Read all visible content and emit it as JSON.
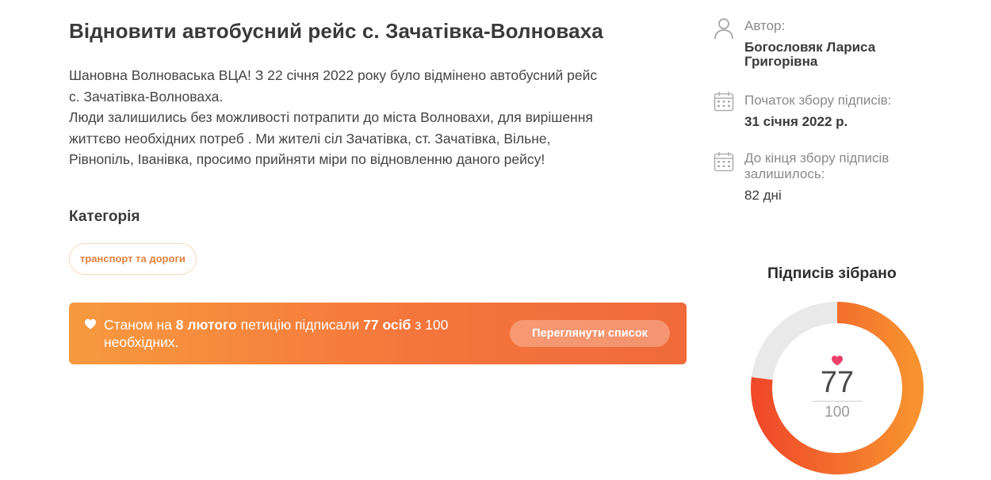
{
  "petition": {
    "title": "Відновити автобусний рейс с. Зачатівка-Волноваха",
    "description_lines": [
      "Шановна Волноваська ВЦА! З 22 січня 2022 року було відмінено автобусний рейс",
      "с. Зачатівка-Волноваха.",
      "Люди залишились без можливості потрапити до міста Волновахи, для вирішення",
      "життєво необхідних потреб . Ми жителі сіл Зачатівка, ст. Зачатівка, Вільне,",
      "Рівнопіль, Іванівка, просимо прийняти міри по відновленню даного рейсу!"
    ]
  },
  "category": {
    "heading": "Категорія",
    "tag": "транспорт та дороги"
  },
  "banner": {
    "text_prefix": "Станом на",
    "date": "8 лютого",
    "text_middle": "петицію підписали",
    "count_text": "77 осіб",
    "text_suffix": "з 100 необхідних.",
    "button_label": "Переглянути список",
    "icon": "heart-icon"
  },
  "sidebar": {
    "author_label": "Автор:",
    "author_name_lines": [
      "Богословяк Лариса",
      "Григорівна"
    ],
    "start_label": "Початок збору підписів:",
    "start_date": "31 січня 2022 р.",
    "remaining_label_lines": [
      "До кінця збору підписів",
      "залишилось:"
    ],
    "remaining_value": "82 дні",
    "icons": [
      "user-icon",
      "calendar-icon",
      "calendar-icon"
    ]
  },
  "signatures": {
    "title": "Підписів зібрано",
    "collected": "77",
    "required": "100",
    "progress_fraction": 0.77
  },
  "colors": {
    "accent_orange": "#f5763c",
    "accent_light": "#f79a3f",
    "ring_track": "#e9e9e9",
    "heart_pink": "#ec3f6b",
    "chip_border": "#f6d9b9",
    "chip_text": "#e0823e"
  }
}
